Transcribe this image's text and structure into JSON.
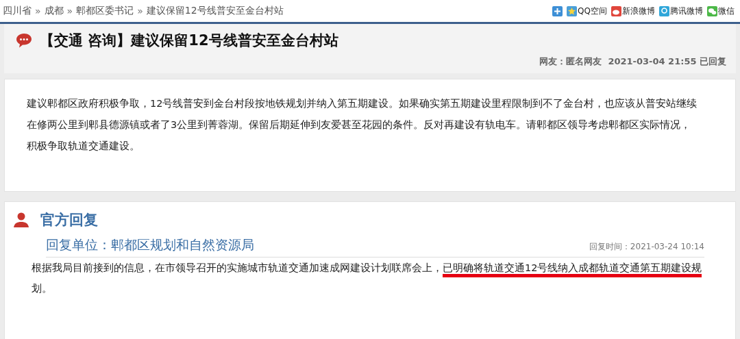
{
  "breadcrumb": [
    "四川省",
    "成都",
    "郫都区委书记",
    "建议保留12号线普安至金台村站"
  ],
  "breadcrumb_separator": "»",
  "share": [
    {
      "kind": "more"
    },
    {
      "kind": "qzone",
      "label": "QQ空间"
    },
    {
      "kind": "sina",
      "label": "新浪微博"
    },
    {
      "kind": "tencent",
      "label": "腾讯微博"
    },
    {
      "kind": "wechat",
      "label": "微信"
    }
  ],
  "post": {
    "title": "【交通 咨询】建议保留12号线普安至金台村站",
    "meta": "网友：匿名网友  2021-03-04 21:55 已回复",
    "body_lines": [
      "建议郫都区政府积极争取，12号线普安到金台村段按地铁规划并纳入第五期建设。如果确实第五期建设里程限制到不了金台村，也应该从普安站继续",
      "在修两公里到郫县德源镇或者了3公里到菁蓉湖。保留后期延伸到友爱甚至花园的条件。反对再建设有轨电车。请郫都区领导考虑郫都区实际情况，",
      "积极争取轨道交通建设。"
    ]
  },
  "reply": {
    "heading": "官方回复",
    "unit": "回复单位：郫都区规划和自然资源局",
    "time": "回复时间：2021-03-24 10:14",
    "lines": [
      [
        {
          "text": "根据我局目前接到的信息，在市领导召开的实施城市轨道交通加速成网建设计划联席会上，",
          "underlined": false
        },
        {
          "text": "已明确将轨道交通12号线纳入成都轨道交通第五期建设规",
          "underlined": true
        }
      ],
      [
        {
          "text": "划。",
          "underlined": false
        }
      ]
    ]
  }
}
